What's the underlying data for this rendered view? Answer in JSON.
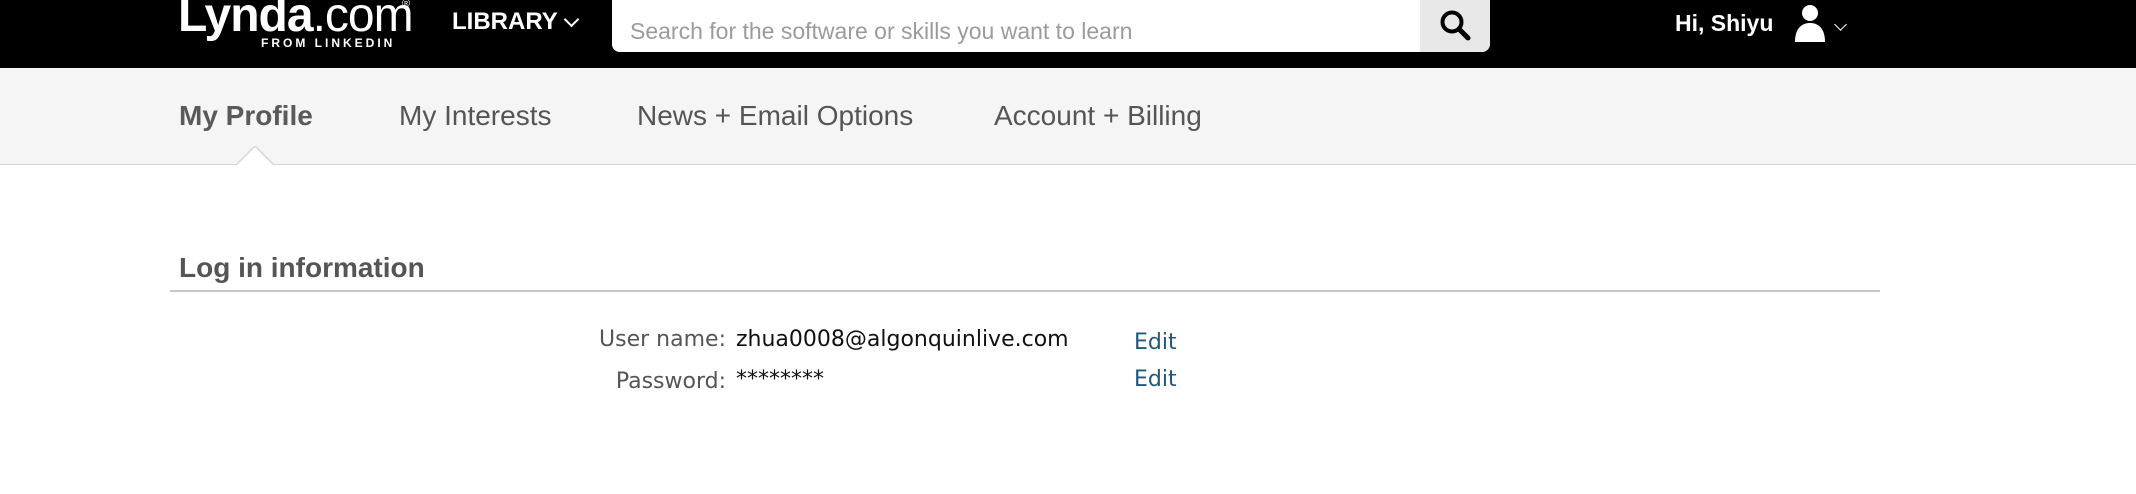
{
  "header": {
    "logo_main_bold": "Lynda",
    "logo_main_light": ".com",
    "logo_registered": "®",
    "logo_sub": "FROM LINKEDIN",
    "library_label": "LIBRARY",
    "search_placeholder": "Search for the software or skills you want to learn",
    "greeting": "Hi, Shiyu",
    "icons": [
      "chevron-down-icon",
      "search-icon",
      "user-icon"
    ]
  },
  "tabs": [
    {
      "label": "My Profile",
      "active": true
    },
    {
      "label": "My Interests",
      "active": false
    },
    {
      "label": "News + Email Options",
      "active": false
    },
    {
      "label": "Account + Billing",
      "active": false
    }
  ],
  "login_info": {
    "title": "Log in information",
    "rows": [
      {
        "label": "User name:",
        "value": "zhua0008@algonquinlive.com",
        "action": "Edit"
      },
      {
        "label": "Password:",
        "value": "********",
        "action": "Edit"
      }
    ]
  },
  "colors": {
    "header_bg": "#000000",
    "tabbar_bg": "#f5f5f5",
    "link": "#23577a",
    "text_gray": "#555555"
  }
}
